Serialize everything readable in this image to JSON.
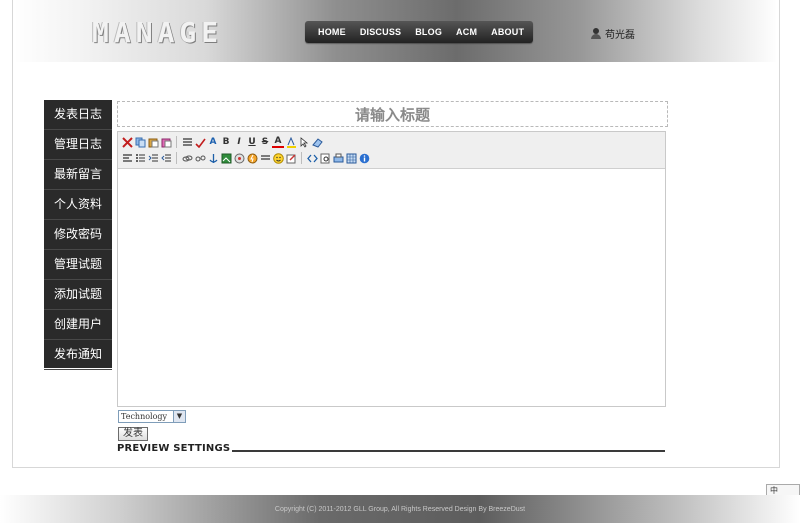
{
  "header": {
    "logo": "MANAGE",
    "nav": [
      "HOME",
      "DISCUSS",
      "BLOG",
      "ACM",
      "ABOUT"
    ],
    "username": "苟光磊"
  },
  "sidebar": {
    "items": [
      "发表日志",
      "管理日志",
      "最新留言",
      "个人资料",
      "修改密码",
      "管理试题",
      "添加试题",
      "创建用户",
      "发布通知"
    ]
  },
  "post": {
    "title_placeholder": "请输入标题",
    "category": "Technology",
    "submit_label": "发表",
    "preview_label": "PREVIEW SETTINGS"
  },
  "toolbar": {
    "row1_icons": [
      "cut-icon",
      "copy-icon",
      "paste-icon",
      "paste-text-icon",
      "ordered-list-icon",
      "spellcheck-icon",
      "font-icon",
      "bold-icon",
      "italic-icon",
      "underline-icon",
      "strikethrough-icon",
      "font-color-icon",
      "bg-color-icon",
      "select-icon",
      "eraser-icon"
    ],
    "row2_icons": [
      "align-left-icon",
      "unordered-list-icon",
      "indent-icon",
      "outdent-icon",
      "link-icon",
      "unlink-icon",
      "anchor-icon",
      "image-icon",
      "media-icon",
      "flash-icon",
      "hr-icon",
      "emoticon-icon",
      "edit-icon",
      "source-icon",
      "preview-icon",
      "print-icon",
      "table-icon",
      "about-icon"
    ],
    "bold_glyph": "B",
    "italic_glyph": "I",
    "underline_glyph": "U",
    "strike_glyph": "S",
    "font_glyph": "A"
  },
  "footer": {
    "text": "Copyright (C) 2011-2012  GLL Group, All Rights Reserved   Design By  BreezeDust"
  },
  "ime": {
    "label": "中"
  }
}
